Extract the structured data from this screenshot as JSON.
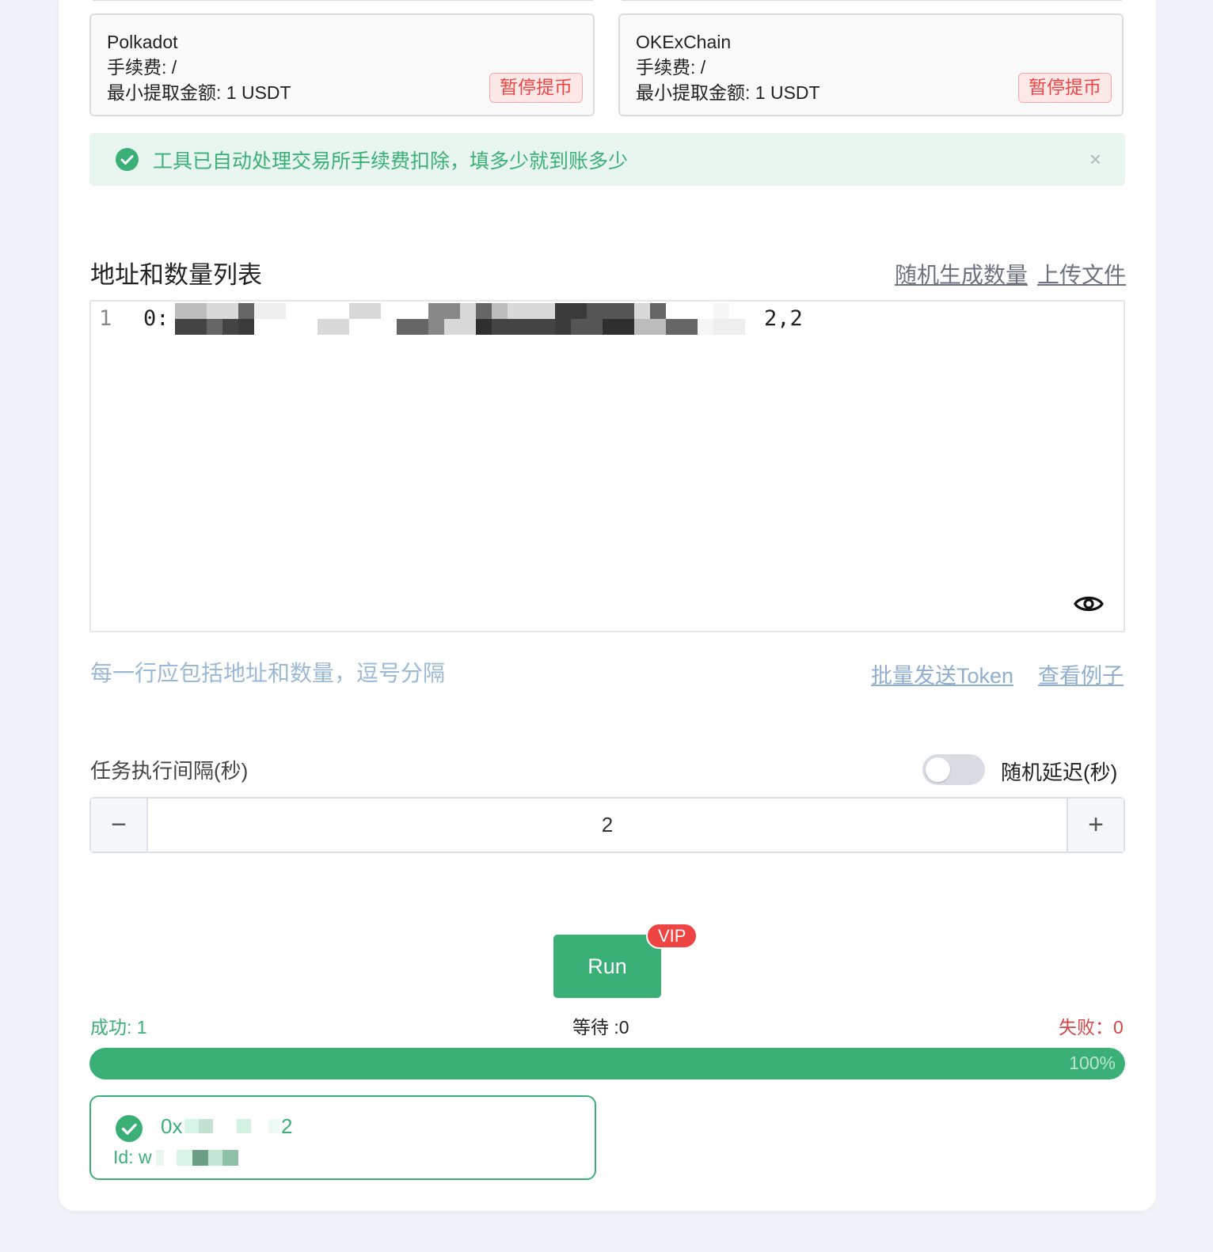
{
  "withdraw_cards": [
    {
      "name": "Polkadot",
      "fee_label": "手续费: /",
      "min_label": "最小提取金额: 1 USDT",
      "status": "暂停提币"
    },
    {
      "name": "OKExChain",
      "fee_label": "手续费: /",
      "min_label": "最小提取金额: 1 USDT",
      "status": "暂停提币"
    }
  ],
  "alert": {
    "text": "工具已自动处理交易所手续费扣除，填多少就到账多少",
    "close": "×"
  },
  "address_list": {
    "title": "地址和数量列表",
    "random_amount_link": "随机生成数量",
    "upload_link": "上传文件",
    "line_number": "1",
    "line_prefix": "0:",
    "line_suffix": "2,2",
    "hint": "每一行应包括地址和数量，逗号分隔",
    "batch_link": "批量发送Token",
    "example_link": "查看例子"
  },
  "interval": {
    "label": "任务执行间隔(秒)",
    "random_delay_label": "随机延迟(秒)",
    "random_delay_enabled": false,
    "minus": "−",
    "plus": "+",
    "value": "2"
  },
  "run": {
    "label": "Run",
    "badge": "VIP"
  },
  "stats": {
    "success": "成功: 1",
    "waiting": "等待 :0",
    "failed": "失败：0",
    "progress_percent": 100,
    "progress_text": "100%"
  },
  "result": {
    "address": "0x",
    "address_tail": "2",
    "id_label": "Id: w"
  },
  "colors": {
    "accent": "#3ab077",
    "danger": "#ef4444",
    "link": "#8faed0"
  }
}
